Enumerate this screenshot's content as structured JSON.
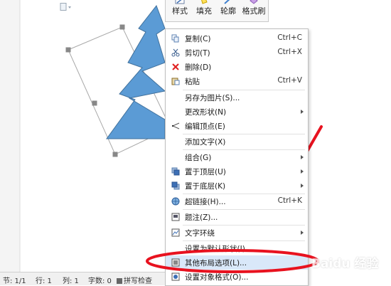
{
  "toolbar": {
    "items": [
      {
        "label": "样式",
        "icon": "brush-icon"
      },
      {
        "label": "填充",
        "icon": "fill-bucket-icon"
      },
      {
        "label": "轮廓",
        "icon": "outline-pen-icon"
      },
      {
        "label": "格式刷",
        "icon": "format-painter-icon"
      }
    ]
  },
  "menu": {
    "items": [
      {
        "label": "复制(C)",
        "shortcut": "Ctrl+C",
        "icon": "copy-icon"
      },
      {
        "label": "剪切(T)",
        "shortcut": "Ctrl+X",
        "icon": "scissors-icon"
      },
      {
        "label": "删除(D)",
        "shortcut": "",
        "icon": "delete-x-icon"
      },
      {
        "label": "粘贴",
        "shortcut": "Ctrl+V",
        "icon": "paste-icon"
      },
      {
        "label": "另存为图片(S)...",
        "shortcut": ""
      },
      {
        "label": "更改形状(N)",
        "shortcut": "",
        "submenu": true
      },
      {
        "label": "编辑顶点(E)",
        "shortcut": "",
        "icon": "edit-points-icon"
      },
      {
        "label": "添加文字(X)",
        "shortcut": ""
      },
      {
        "label": "组合(G)",
        "shortcut": "",
        "submenu": true
      },
      {
        "label": "置于顶层(U)",
        "shortcut": "",
        "icon": "bring-front-icon",
        "submenu": true
      },
      {
        "label": "置于底层(K)",
        "shortcut": "",
        "icon": "send-back-icon",
        "submenu": true
      },
      {
        "label": "超链接(H)...",
        "shortcut": "Ctrl+K",
        "icon": "hyperlink-globe-icon"
      },
      {
        "label": "题注(Z)...",
        "shortcut": "",
        "icon": "caption-icon"
      },
      {
        "label": "文字环绕",
        "shortcut": "",
        "icon": "text-wrap-icon",
        "submenu": true
      },
      {
        "label": "设置为默认形状(I)",
        "shortcut": ""
      },
      {
        "label": "其他布局选项(L)...",
        "shortcut": "",
        "icon": "layout-options-icon",
        "highlighted": true
      },
      {
        "label": "设置对象格式(O)...",
        "shortcut": "",
        "icon": "format-object-icon"
      }
    ]
  },
  "status_bar": {
    "section": "节: 1/1",
    "line": "行: 1",
    "column": "列: 1",
    "word_count": "字数: 0",
    "spell_check": "拼写检查"
  },
  "watermark": "Baidu 经验",
  "colors": {
    "shape_fill": "#5b9bd5",
    "shape_stroke": "#41719c",
    "annotation_red": "#e8121f",
    "menu_highlight": "#d9e8f9"
  }
}
